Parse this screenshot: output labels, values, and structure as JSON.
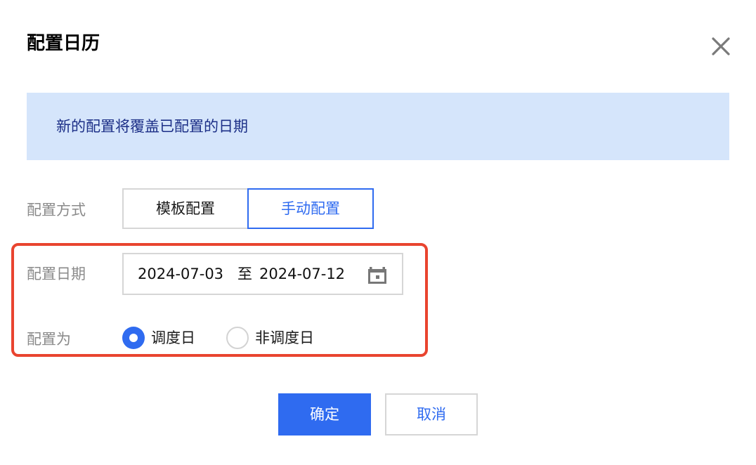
{
  "dialog": {
    "title": "配置日历",
    "close_icon": "close-icon"
  },
  "alert": {
    "text": "新的配置将覆盖已配置的日期",
    "background": "#d5e5fb",
    "text_color": "#1c2f87"
  },
  "config_mode": {
    "label": "配置方式",
    "options": [
      "模板配置",
      "手动配置"
    ],
    "selected": "手动配置"
  },
  "config_date": {
    "label": "配置日期",
    "start": "2024-07-03",
    "separator": "至",
    "end": "2024-07-12",
    "icon": "calendar-icon"
  },
  "config_as": {
    "label": "配置为",
    "options": [
      "调度日",
      "非调度日"
    ],
    "selected": "调度日"
  },
  "footer": {
    "ok_label": "确定",
    "cancel_label": "取消"
  },
  "colors": {
    "accent": "#2f6bf0",
    "highlight_border": "#e9442f"
  }
}
